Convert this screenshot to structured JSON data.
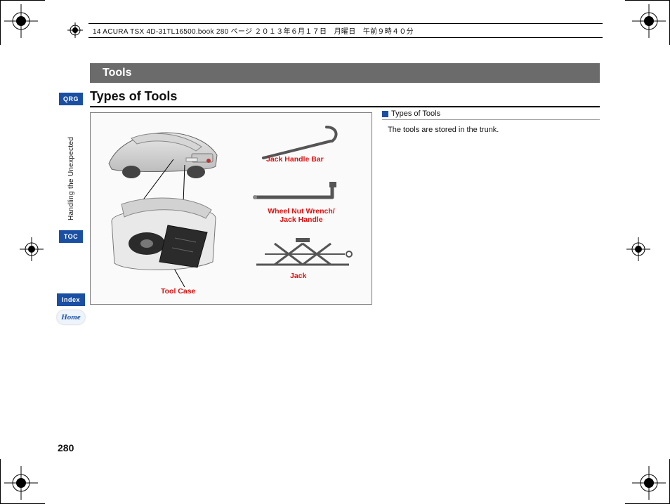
{
  "meta": {
    "header_line": "14 ACURA TSX 4D-31TL16500.book  280 ページ  ２０１３年６月１７日　月曜日　午前９時４０分"
  },
  "chapter": {
    "title": "Tools"
  },
  "section": {
    "heading": "Types of Tools"
  },
  "sidebar": {
    "qrg": "QRG",
    "vertical": "Handling the Unexpected",
    "toc": "TOC",
    "index": "Index",
    "home": "Home"
  },
  "page_number": "280",
  "figure": {
    "labels": {
      "tool_case": "Tool Case",
      "jack_handle_bar": "Jack Handle Bar",
      "wheel_nut_wrench": "Wheel Nut Wrench/\nJack Handle",
      "jack": "Jack"
    }
  },
  "info": {
    "heading": "Types of Tools",
    "body": "The tools are stored in the trunk."
  }
}
